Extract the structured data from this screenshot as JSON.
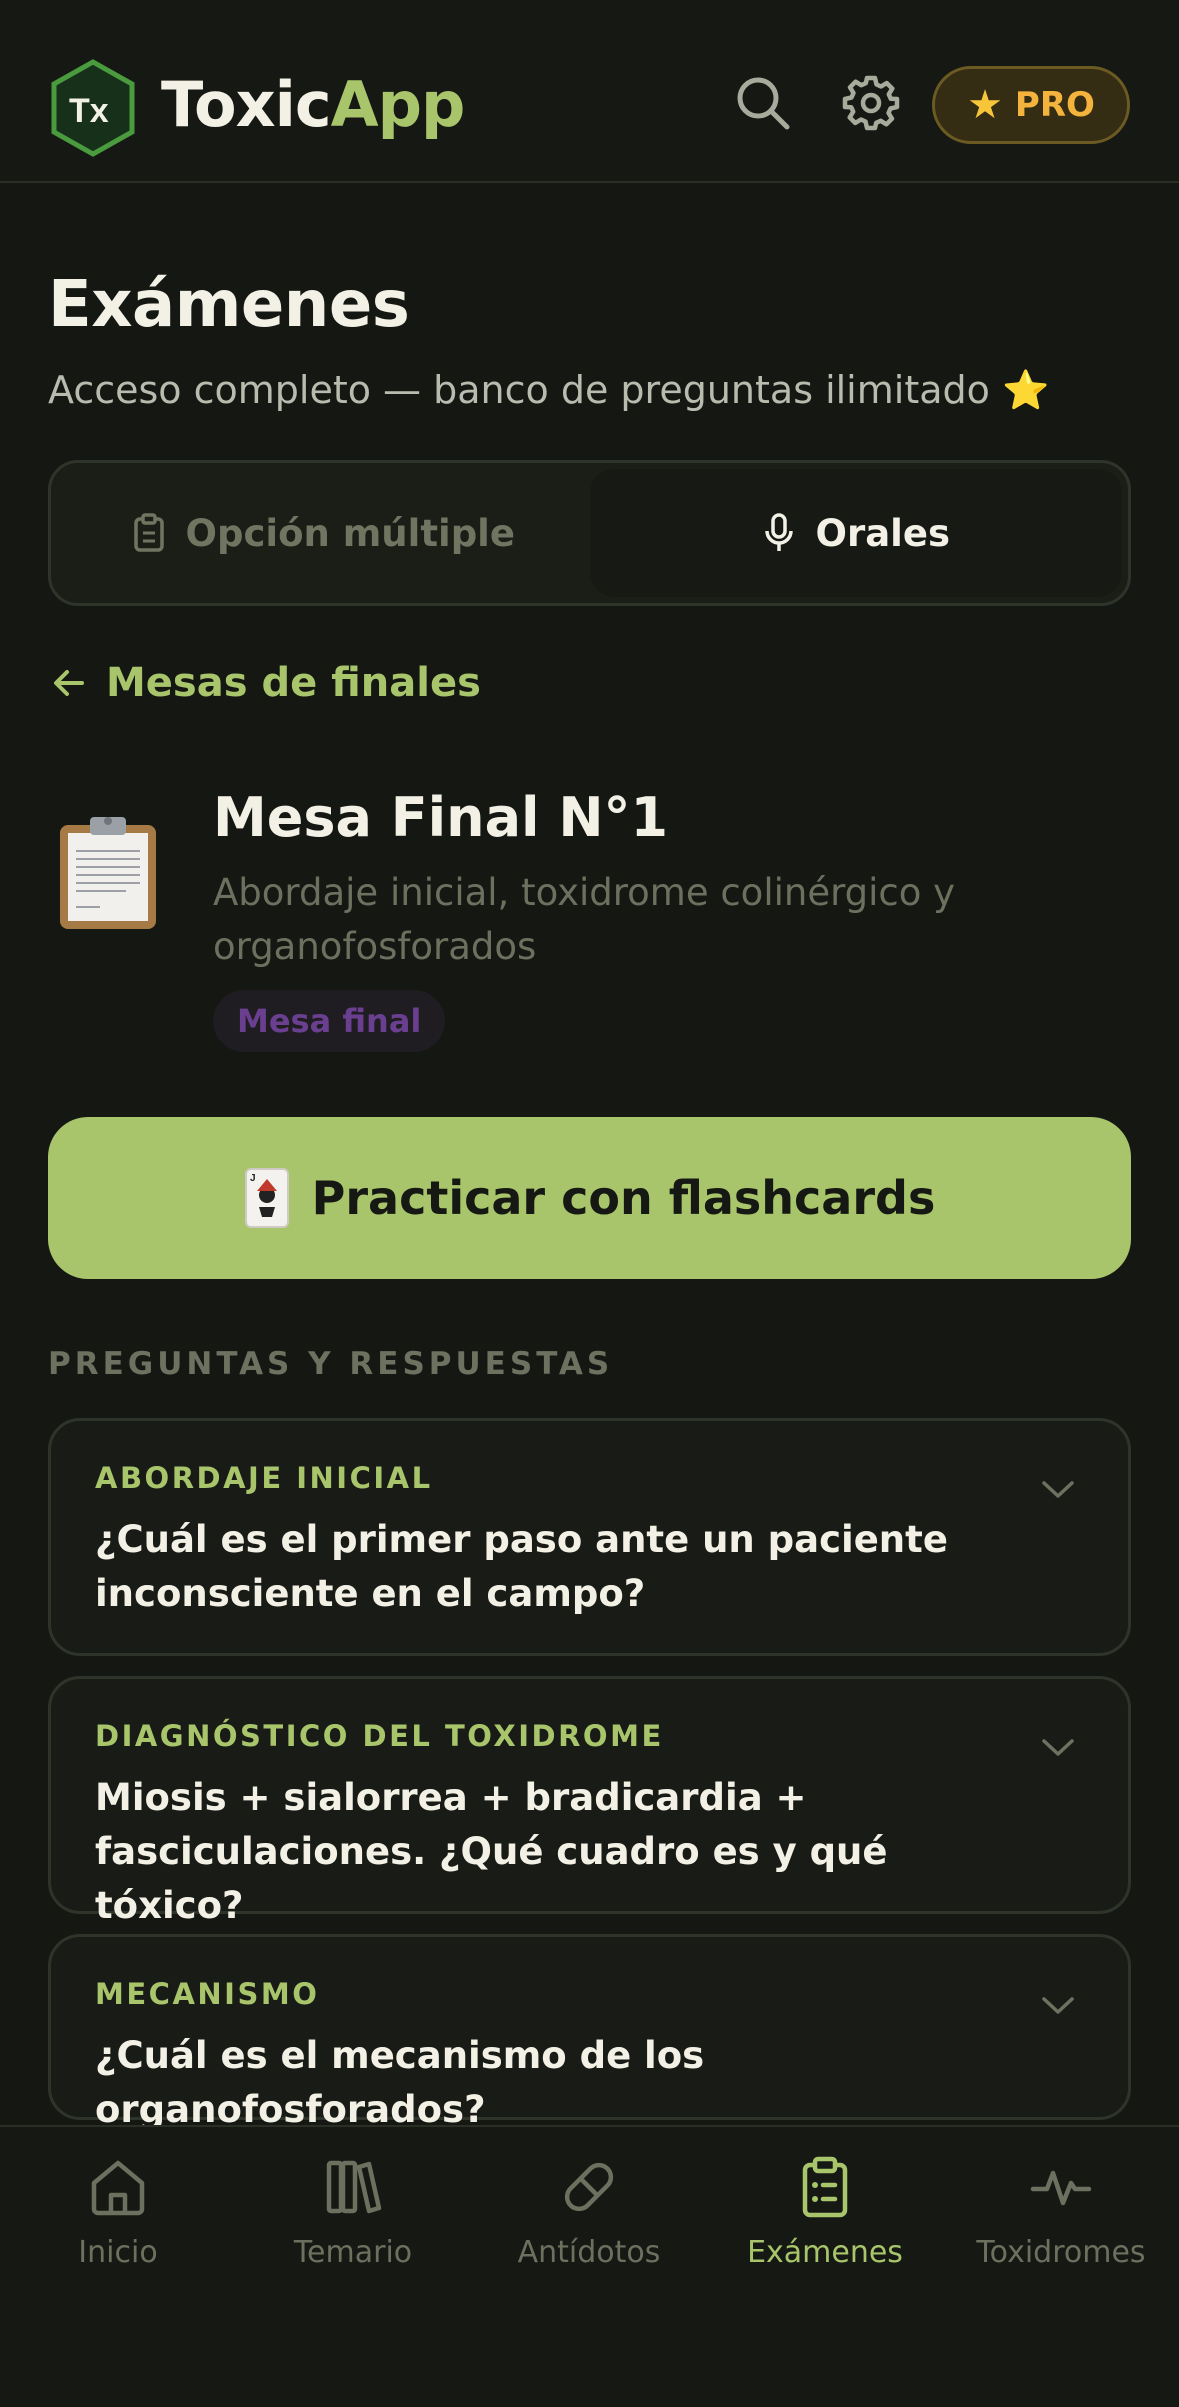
{
  "header": {
    "brand_part1": "Toxic",
    "brand_part2": "App",
    "logo_text": "Tx",
    "pro_label": "PRO",
    "pro_icon": "star-icon"
  },
  "page": {
    "title": "Exámenes",
    "subtitle": "Acceso completo — banco de preguntas ilimitado",
    "subtitle_emoji": "⭐"
  },
  "tabs": [
    {
      "label": "Opción múltiple",
      "icon": "clipboard-icon",
      "active": false
    },
    {
      "label": "Orales",
      "icon": "microphone-icon",
      "active": true
    }
  ],
  "back_link": {
    "label": "Mesas de finales"
  },
  "mesa": {
    "title": "Mesa Final N°1",
    "description": "Abordaje inicial, toxidrome colinérgico y organofosforados",
    "badge": "Mesa final"
  },
  "flashcards_button": {
    "label": "Practicar con flashcards"
  },
  "section_label": "PREGUNTAS Y RESPUESTAS",
  "questions": [
    {
      "category": "ABORDAJE INICIAL",
      "question": "¿Cuál es el primer paso ante un paciente inconsciente en el campo?"
    },
    {
      "category": "DIAGNÓSTICO DEL TOXIDROME",
      "question": "Miosis + sialorrea + bradicardia + fasciculaciones. ¿Qué cuadro es y qué tóxico?"
    },
    {
      "category": "MECANISMO",
      "question": "¿Cuál es el mecanismo de los organofosforados?"
    }
  ],
  "nav": [
    {
      "label": "Inicio",
      "icon": "home-icon",
      "active": false
    },
    {
      "label": "Temario",
      "icon": "books-icon",
      "active": false
    },
    {
      "label": "Antídotos",
      "icon": "pill-icon",
      "active": false
    },
    {
      "label": "Exámenes",
      "icon": "clipboard-list-icon",
      "active": true
    },
    {
      "label": "Toxidromes",
      "icon": "pulse-icon",
      "active": false
    }
  ],
  "colors": {
    "background": "#141712",
    "accent": "#a9c56b",
    "pro_gold": "#f3b33c",
    "badge_purple": "#6b3f8f"
  }
}
